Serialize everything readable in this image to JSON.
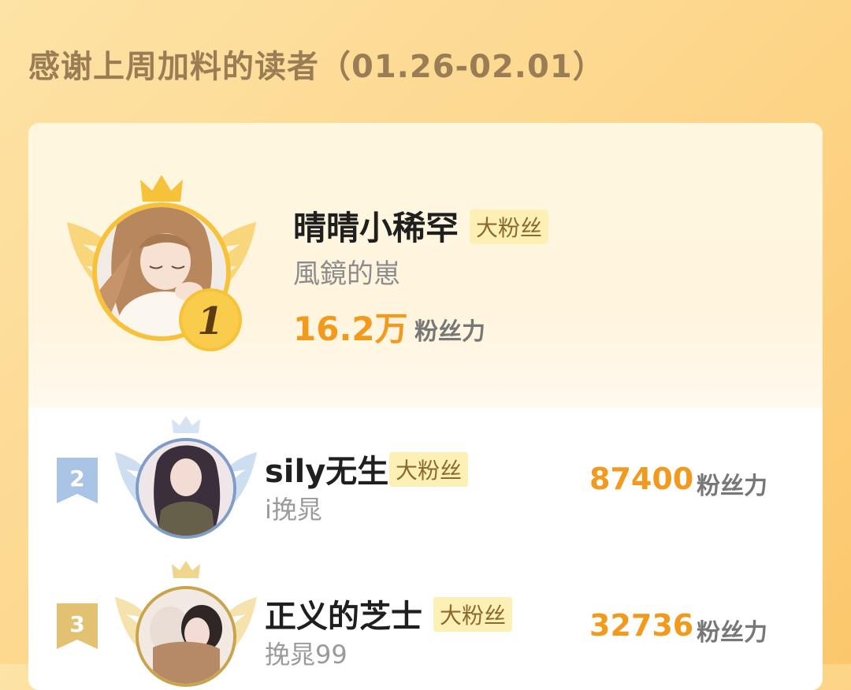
{
  "header": {
    "title": "感谢上周加料的读者（01.26-02.01）"
  },
  "badge_label": "大粉丝",
  "fans_unit": "粉丝力",
  "ranks": [
    {
      "rank": "1",
      "name": "晴晴小稀罕",
      "subtitle": "風鏡的崽",
      "fans": "16.2万",
      "avatar": "avatar-girl-long-hair"
    },
    {
      "rank": "2",
      "name": "sily无生",
      "subtitle": "i挽晁",
      "fans": "87400",
      "avatar": "avatar-girl-dark-hair"
    },
    {
      "rank": "3",
      "name": "正义的芝士",
      "subtitle": "挽晁99",
      "fans": "32736",
      "avatar": "avatar-couple"
    }
  ],
  "colors": {
    "accent": "#f29a1d",
    "gold": "#f7c23a",
    "silver": "#a9c4e4",
    "bronze": "#e2c272"
  }
}
